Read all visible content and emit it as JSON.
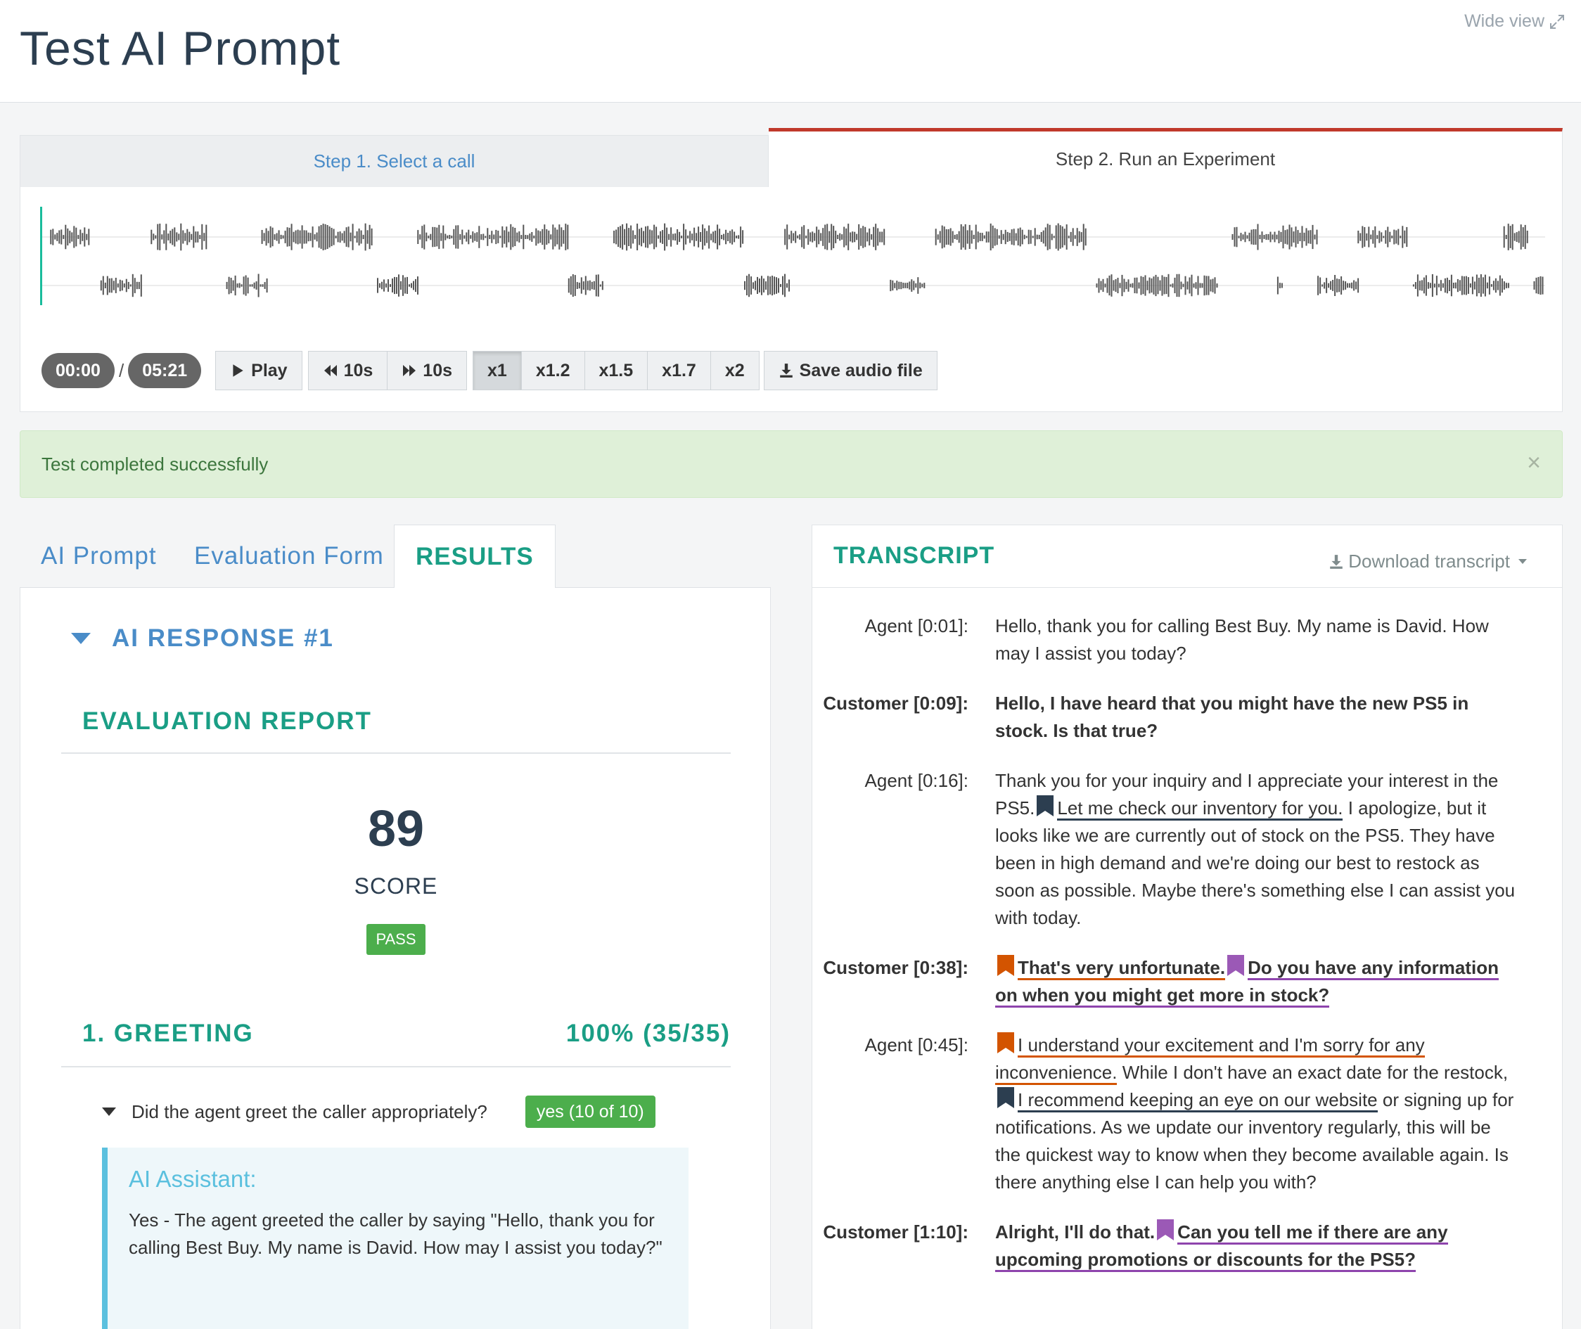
{
  "header": {
    "title": "Test AI Prompt",
    "wide_view": "Wide view"
  },
  "steps": {
    "step1": "Step 1. Select a call",
    "step2": "Step 2. Run an Experiment"
  },
  "player": {
    "current_time": "00:00",
    "separator": "/",
    "duration": "05:21",
    "play": "Play",
    "back": "10s",
    "forward": "10s",
    "speeds": [
      "x1",
      "x1.2",
      "x1.5",
      "x1.7",
      "x2"
    ],
    "save": "Save audio file"
  },
  "alert": {
    "message": "Test completed successfully",
    "close": "×"
  },
  "tabs": {
    "ai_prompt": "AI Prompt",
    "evaluation_form": "Evaluation Form",
    "results": "RESULTS"
  },
  "results": {
    "response_title": "AI RESPONSE #1",
    "eval_title": "EVALUATION REPORT",
    "score": "89",
    "score_label": "SCORE",
    "pass": "PASS",
    "section_title": "1. GREETING",
    "section_score": "100% (35/35)",
    "question": "Did the agent greet the caller appropriately?",
    "answer": "yes (10 of 10)",
    "ai_title": "AI Assistant:",
    "ai_text": "Yes - The agent greeted the caller by saying \"Hello, thank you for calling Best Buy. My name is David. How may I assist you today?\""
  },
  "transcript": {
    "title": "TRANSCRIPT",
    "download": "Download transcript",
    "e1": {
      "speaker": "Agent [0:01]:",
      "text": "Hello, thank you for calling Best Buy. My name is David. How may I assist you today?"
    },
    "e2": {
      "speaker": "Customer [0:09]:",
      "text": "Hello, I have heard that you might have the new PS5 in stock. Is that true?"
    },
    "e3": {
      "speaker": "Agent [0:16]:",
      "p1": "Thank you for your inquiry and I appreciate your interest in the PS5.",
      "h1": "Let me check our inventory for you.",
      "p2": " I apologize, but it looks like we are currently out of stock on the PS5. They have been in high demand and we're doing our best to restock as soon as possible. Maybe there's something else I can assist you with today."
    },
    "e4": {
      "speaker": "Customer [0:38]:",
      "h1": "That's very unfortunate.",
      "h2": "Do you have any information on when you might get more in stock?"
    },
    "e5": {
      "speaker": "Agent [0:45]:",
      "h1": "I understand your excitement and I'm sorry for any inconvenience.",
      "p1": " While I don't have an exact date for the restock,",
      "h2": "I recommend keeping an eye on our website",
      "p2": " or signing up for notifications. As we update our inventory regularly, this will be the quickest way to know when they become available again. Is there anything else I can help you with?"
    },
    "e6": {
      "speaker": "Customer [1:10]:",
      "p1": "Alright, I'll do that.",
      "h1": "Can you tell me if there are any upcoming promotions or discounts for the PS5?"
    }
  },
  "colors": {
    "accent_green": "#1a9e85",
    "link_blue": "#4a8cc8",
    "step_active": "#c0392b",
    "pass_green": "#4cae4c",
    "bookmark_navy": "#2c3e50",
    "bookmark_orange": "#d35400",
    "bookmark_purple": "#9b59b6"
  },
  "icons": [
    "expand-icon",
    "play-icon",
    "rewind-icon",
    "fast-forward-icon",
    "download-icon",
    "bookmark-icon",
    "caret-down-icon",
    "close-icon"
  ]
}
